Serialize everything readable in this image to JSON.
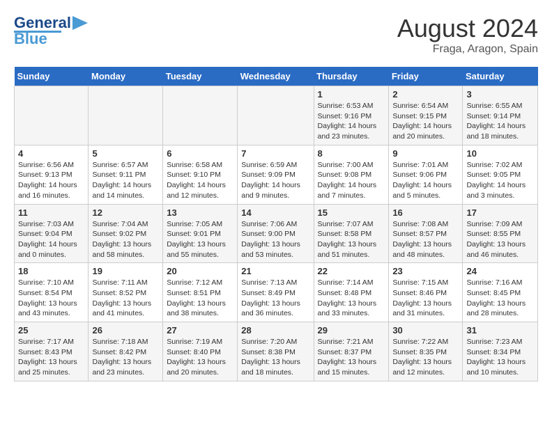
{
  "logo": {
    "line1": "General",
    "line2": "Blue"
  },
  "title": "August 2024",
  "subtitle": "Fraga, Aragon, Spain",
  "days_header": [
    "Sunday",
    "Monday",
    "Tuesday",
    "Wednesday",
    "Thursday",
    "Friday",
    "Saturday"
  ],
  "weeks": [
    [
      {
        "day": "",
        "info": ""
      },
      {
        "day": "",
        "info": ""
      },
      {
        "day": "",
        "info": ""
      },
      {
        "day": "",
        "info": ""
      },
      {
        "day": "1",
        "info": "Sunrise: 6:53 AM\nSunset: 9:16 PM\nDaylight: 14 hours\nand 23 minutes."
      },
      {
        "day": "2",
        "info": "Sunrise: 6:54 AM\nSunset: 9:15 PM\nDaylight: 14 hours\nand 20 minutes."
      },
      {
        "day": "3",
        "info": "Sunrise: 6:55 AM\nSunset: 9:14 PM\nDaylight: 14 hours\nand 18 minutes."
      }
    ],
    [
      {
        "day": "4",
        "info": "Sunrise: 6:56 AM\nSunset: 9:13 PM\nDaylight: 14 hours\nand 16 minutes."
      },
      {
        "day": "5",
        "info": "Sunrise: 6:57 AM\nSunset: 9:11 PM\nDaylight: 14 hours\nand 14 minutes."
      },
      {
        "day": "6",
        "info": "Sunrise: 6:58 AM\nSunset: 9:10 PM\nDaylight: 14 hours\nand 12 minutes."
      },
      {
        "day": "7",
        "info": "Sunrise: 6:59 AM\nSunset: 9:09 PM\nDaylight: 14 hours\nand 9 minutes."
      },
      {
        "day": "8",
        "info": "Sunrise: 7:00 AM\nSunset: 9:08 PM\nDaylight: 14 hours\nand 7 minutes."
      },
      {
        "day": "9",
        "info": "Sunrise: 7:01 AM\nSunset: 9:06 PM\nDaylight: 14 hours\nand 5 minutes."
      },
      {
        "day": "10",
        "info": "Sunrise: 7:02 AM\nSunset: 9:05 PM\nDaylight: 14 hours\nand 3 minutes."
      }
    ],
    [
      {
        "day": "11",
        "info": "Sunrise: 7:03 AM\nSunset: 9:04 PM\nDaylight: 14 hours\nand 0 minutes."
      },
      {
        "day": "12",
        "info": "Sunrise: 7:04 AM\nSunset: 9:02 PM\nDaylight: 13 hours\nand 58 minutes."
      },
      {
        "day": "13",
        "info": "Sunrise: 7:05 AM\nSunset: 9:01 PM\nDaylight: 13 hours\nand 55 minutes."
      },
      {
        "day": "14",
        "info": "Sunrise: 7:06 AM\nSunset: 9:00 PM\nDaylight: 13 hours\nand 53 minutes."
      },
      {
        "day": "15",
        "info": "Sunrise: 7:07 AM\nSunset: 8:58 PM\nDaylight: 13 hours\nand 51 minutes."
      },
      {
        "day": "16",
        "info": "Sunrise: 7:08 AM\nSunset: 8:57 PM\nDaylight: 13 hours\nand 48 minutes."
      },
      {
        "day": "17",
        "info": "Sunrise: 7:09 AM\nSunset: 8:55 PM\nDaylight: 13 hours\nand 46 minutes."
      }
    ],
    [
      {
        "day": "18",
        "info": "Sunrise: 7:10 AM\nSunset: 8:54 PM\nDaylight: 13 hours\nand 43 minutes."
      },
      {
        "day": "19",
        "info": "Sunrise: 7:11 AM\nSunset: 8:52 PM\nDaylight: 13 hours\nand 41 minutes."
      },
      {
        "day": "20",
        "info": "Sunrise: 7:12 AM\nSunset: 8:51 PM\nDaylight: 13 hours\nand 38 minutes."
      },
      {
        "day": "21",
        "info": "Sunrise: 7:13 AM\nSunset: 8:49 PM\nDaylight: 13 hours\nand 36 minutes."
      },
      {
        "day": "22",
        "info": "Sunrise: 7:14 AM\nSunset: 8:48 PM\nDaylight: 13 hours\nand 33 minutes."
      },
      {
        "day": "23",
        "info": "Sunrise: 7:15 AM\nSunset: 8:46 PM\nDaylight: 13 hours\nand 31 minutes."
      },
      {
        "day": "24",
        "info": "Sunrise: 7:16 AM\nSunset: 8:45 PM\nDaylight: 13 hours\nand 28 minutes."
      }
    ],
    [
      {
        "day": "25",
        "info": "Sunrise: 7:17 AM\nSunset: 8:43 PM\nDaylight: 13 hours\nand 25 minutes."
      },
      {
        "day": "26",
        "info": "Sunrise: 7:18 AM\nSunset: 8:42 PM\nDaylight: 13 hours\nand 23 minutes."
      },
      {
        "day": "27",
        "info": "Sunrise: 7:19 AM\nSunset: 8:40 PM\nDaylight: 13 hours\nand 20 minutes."
      },
      {
        "day": "28",
        "info": "Sunrise: 7:20 AM\nSunset: 8:38 PM\nDaylight: 13 hours\nand 18 minutes."
      },
      {
        "day": "29",
        "info": "Sunrise: 7:21 AM\nSunset: 8:37 PM\nDaylight: 13 hours\nand 15 minutes."
      },
      {
        "day": "30",
        "info": "Sunrise: 7:22 AM\nSunset: 8:35 PM\nDaylight: 13 hours\nand 12 minutes."
      },
      {
        "day": "31",
        "info": "Sunrise: 7:23 AM\nSunset: 8:34 PM\nDaylight: 13 hours\nand 10 minutes."
      }
    ]
  ]
}
